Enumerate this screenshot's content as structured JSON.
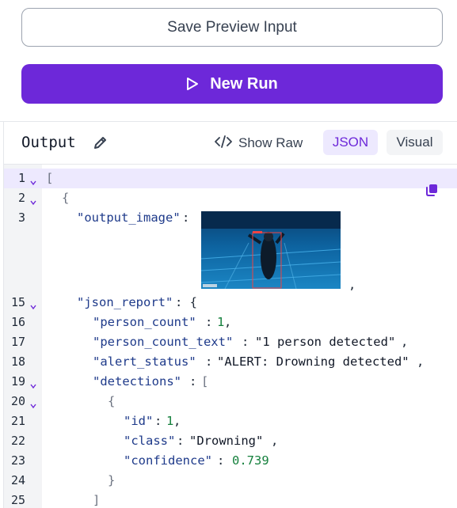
{
  "buttons": {
    "save_preview_label": "Save Preview Input",
    "new_run_label": "New Run"
  },
  "output": {
    "title": "Output",
    "show_raw_label": "Show Raw",
    "tabs": [
      {
        "label": "JSON",
        "active": true
      },
      {
        "label": "Visual",
        "active": false
      }
    ]
  },
  "code": {
    "ln": {
      "l1": "1",
      "l2": "2",
      "l3": "3",
      "l15": "15",
      "l16": "16",
      "l17": "17",
      "l18": "18",
      "l19": "19",
      "l20": "20",
      "l21": "21",
      "l22": "22",
      "l23": "23",
      "l24": "24",
      "l25": "25"
    },
    "open_bracket": "[",
    "open_brace": "{",
    "close_brace": "}",
    "close_bracket": "]",
    "output_image_key": "\"output_image\"",
    "json_report_key": "\"json_report\"",
    "person_count_key": "\"person_count\"",
    "person_count_value": "1",
    "person_count_text_key": "\"person_count_text\"",
    "person_count_text_value": "\"1 person detected\"",
    "alert_status_key": "\"alert_status\"",
    "alert_status_value": "\"ALERT: Drowning detected\"",
    "detections_key": "\"detections\"",
    "id_key": "\"id\"",
    "id_value": "1",
    "class_key": "\"class\"",
    "class_value": "\"Drowning\"",
    "confidence_key": "\"confidence\"",
    "confidence_value": "0.739"
  },
  "colors": {
    "accent": "#6d28d9",
    "accent_light": "#ede9fe",
    "json_key": "#1e3a8a",
    "json_number": "#15803d"
  },
  "icons": [
    "play-icon",
    "pencil-icon",
    "code-icon",
    "copy-icon",
    "chevron-down-icon"
  ]
}
